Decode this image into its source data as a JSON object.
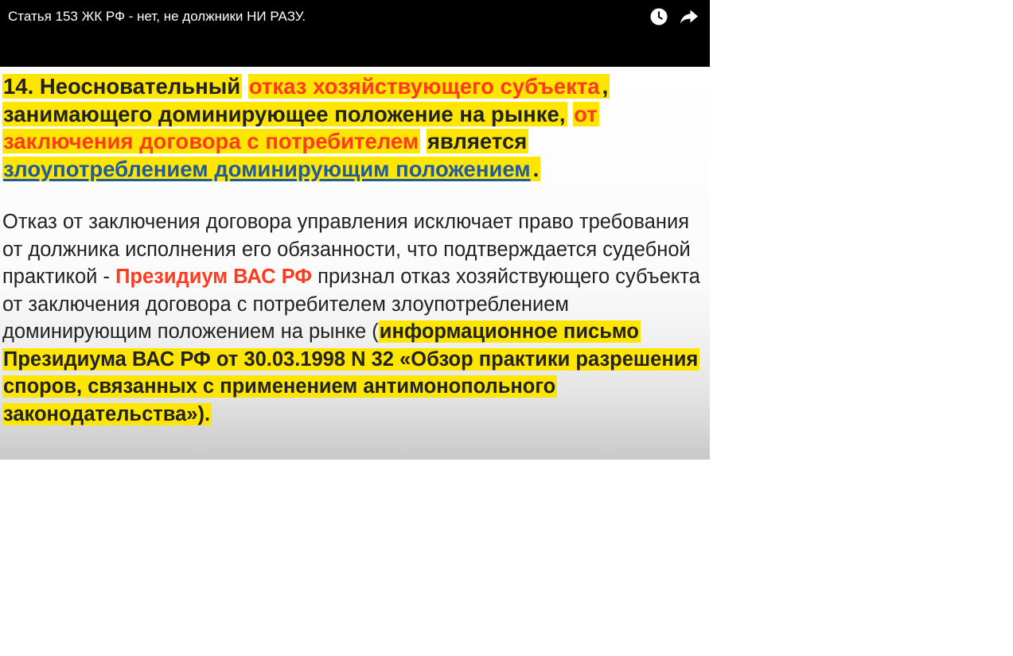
{
  "video": {
    "title": "Статья 153 ЖК РФ - нет, не должники НИ РАЗУ."
  },
  "controls": {
    "watch_later_icon": "clock-icon",
    "share_icon": "share-arrow-icon"
  },
  "colors": {
    "highlight": "#ffe600",
    "accent_red": "#ff3b1f",
    "link_blue": "#1f5b9e"
  },
  "slide": {
    "para1": {
      "s1": "14. Неосновательный",
      "s2": "отказ хозяйствующего субъекта",
      "s3": ",",
      "s4": "занимающего доминирующее положение на рынке,",
      "s5": "от заключения договора с потребителем",
      "s6": "является",
      "s7": "злоупотреблением доминирующим положением",
      "s8": "."
    },
    "para2": {
      "t1": "Отказ от заключения договора управления исключает право требования от должника исполнения его обязанности, что подтверждается судебной практикой -",
      "t2": "Президиум ВАС РФ",
      "t3": "признал отказ хозяйствующего субъекта от заключения договора с потребителем злоупотреблением доминирующим положением на рынке (",
      "t4": "информационное письмо Президиума ВАС РФ от 30.03.1998 N 32 «Обзор практики разрешения споров, связанных с применением антимонопольного законодательства»)."
    }
  }
}
